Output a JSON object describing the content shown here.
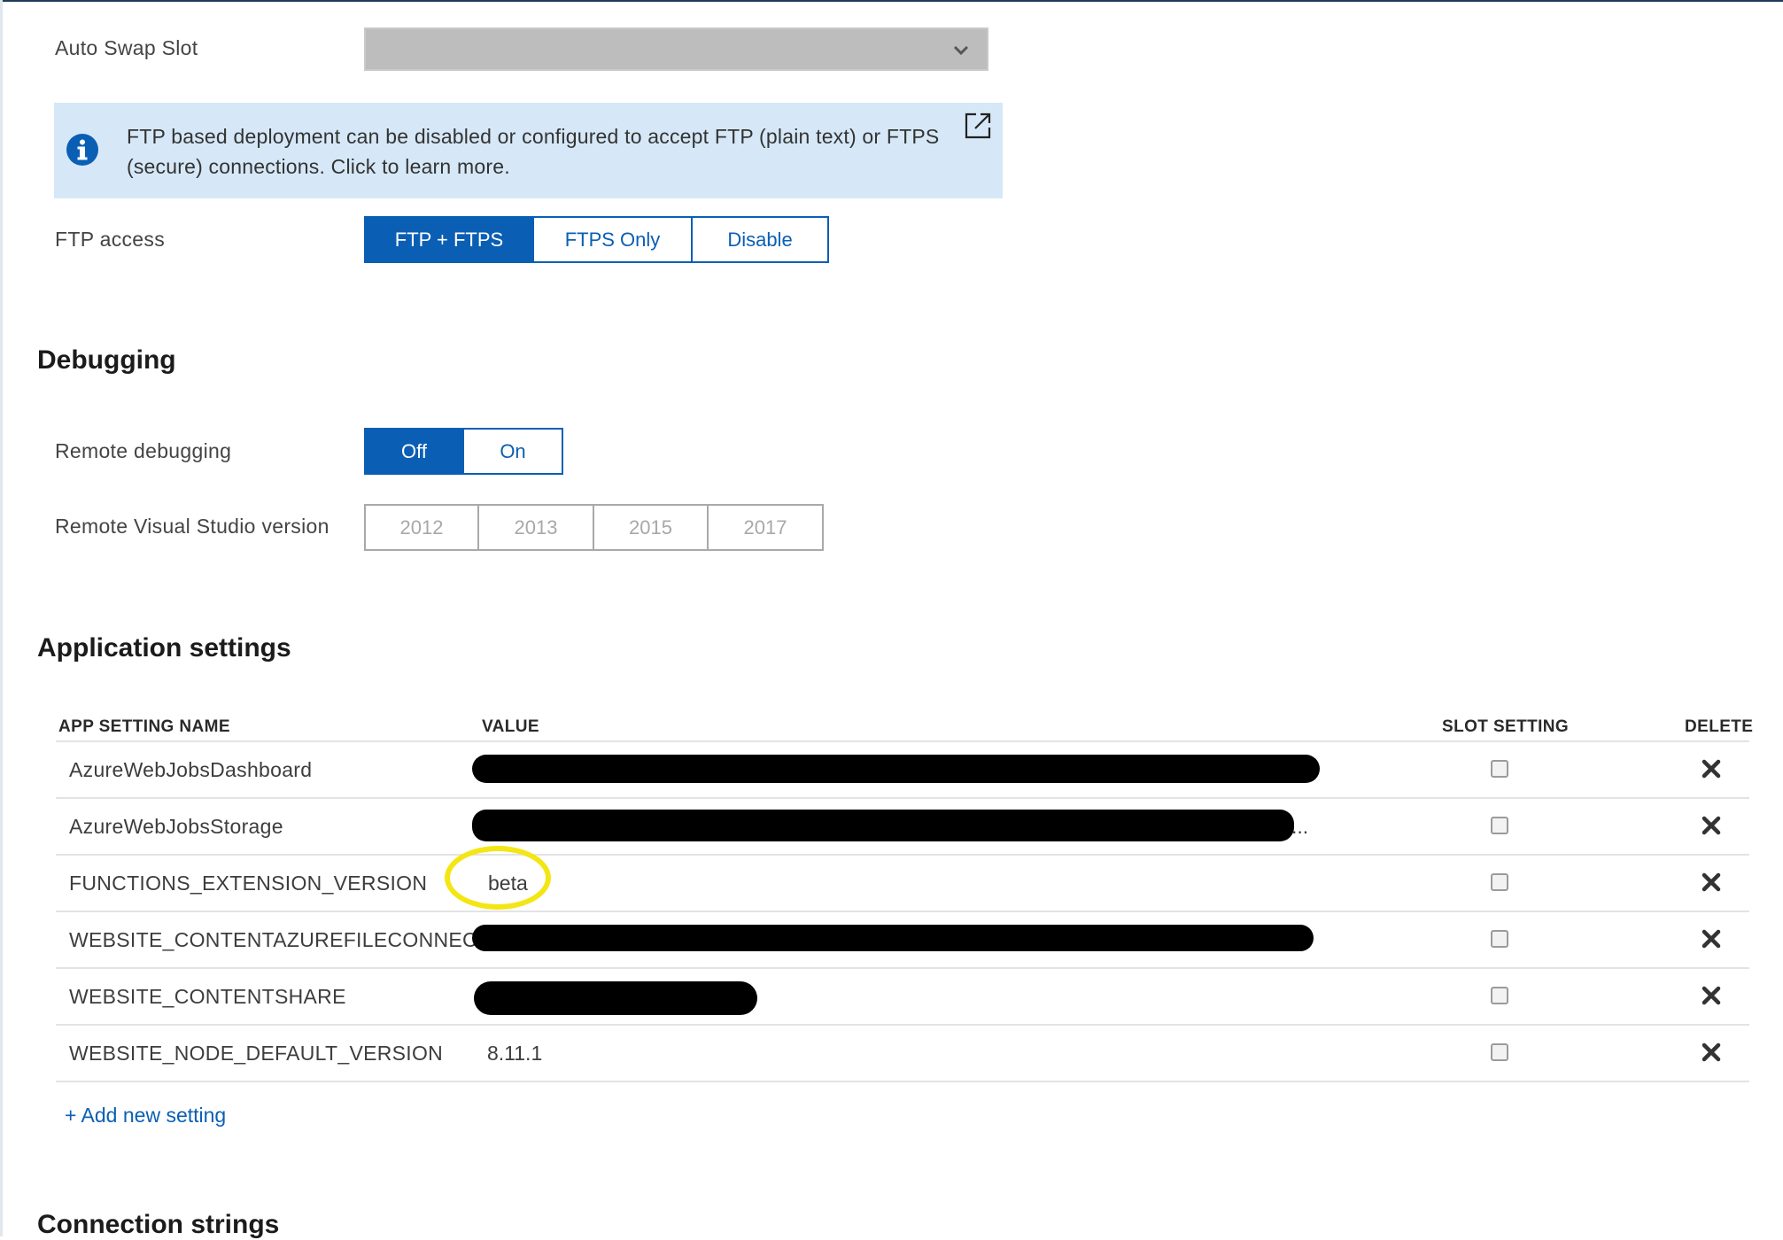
{
  "auto_swap": {
    "label": "Auto Swap Slot"
  },
  "info_banner": {
    "text": "FTP based deployment can be disabled or configured to accept FTP (plain text) or FTPS (secure) connections. Click to learn more."
  },
  "ftp_access": {
    "label": "FTP access",
    "options": [
      "FTP + FTPS",
      "FTPS Only",
      "Disable"
    ],
    "selected": "FTP + FTPS"
  },
  "debugging": {
    "heading": "Debugging",
    "remote_debugging": {
      "label": "Remote debugging",
      "options": [
        "Off",
        "On"
      ],
      "selected": "Off"
    },
    "vs_version": {
      "label": "Remote Visual Studio version",
      "options": [
        "2012",
        "2013",
        "2015",
        "2017"
      ]
    }
  },
  "app_settings": {
    "heading": "Application settings",
    "columns": {
      "name": "APP SETTING NAME",
      "value": "VALUE",
      "slot": "SLOT SETTING",
      "delete": "DELETE"
    },
    "rows": [
      {
        "name": "AzureWebJobsDashboard",
        "value": ""
      },
      {
        "name": "AzureWebJobsStorage",
        "value": "..."
      },
      {
        "name": "FUNCTIONS_EXTENSION_VERSION",
        "value": "beta"
      },
      {
        "name": "WEBSITE_CONTENTAZUREFILECONNECT...",
        "value": ""
      },
      {
        "name": "WEBSITE_CONTENTSHARE",
        "value": ""
      },
      {
        "name": "WEBSITE_NODE_DEFAULT_VERSION",
        "value": "8.11.1"
      }
    ],
    "add_link": "+ Add new setting"
  },
  "connection_strings": {
    "heading": "Connection strings"
  },
  "colors": {
    "accent": "#0a5fb4",
    "info_bg": "#d6e8f7",
    "highlight": "#f3e614"
  }
}
